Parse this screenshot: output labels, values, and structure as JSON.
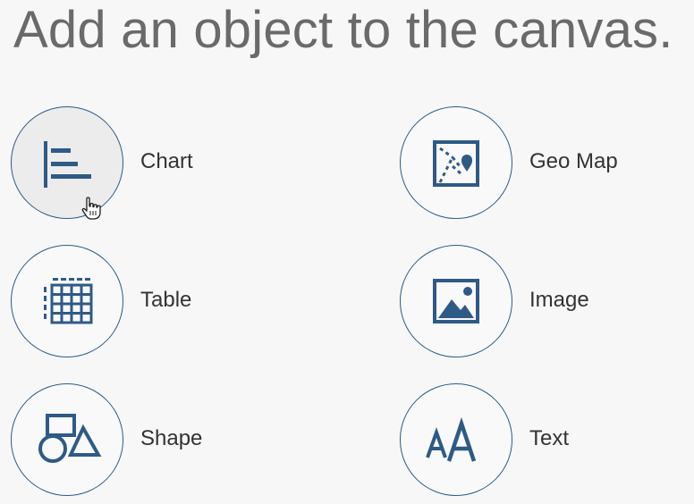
{
  "header": {
    "title": "Add an object to the canvas."
  },
  "objects": [
    {
      "label": "Chart",
      "icon": "bar-chart-icon"
    },
    {
      "label": "Geo Map",
      "icon": "geo-map-icon"
    },
    {
      "label": "Table",
      "icon": "table-icon"
    },
    {
      "label": "Image",
      "icon": "image-icon"
    },
    {
      "label": "Shape",
      "icon": "shape-icon"
    },
    {
      "label": "Text",
      "icon": "text-icon"
    }
  ],
  "colors": {
    "accent": "#2e5a87",
    "title": "#6a6a6a",
    "label": "#333333",
    "background": "#f7f7f7",
    "hover": "#ececec"
  }
}
